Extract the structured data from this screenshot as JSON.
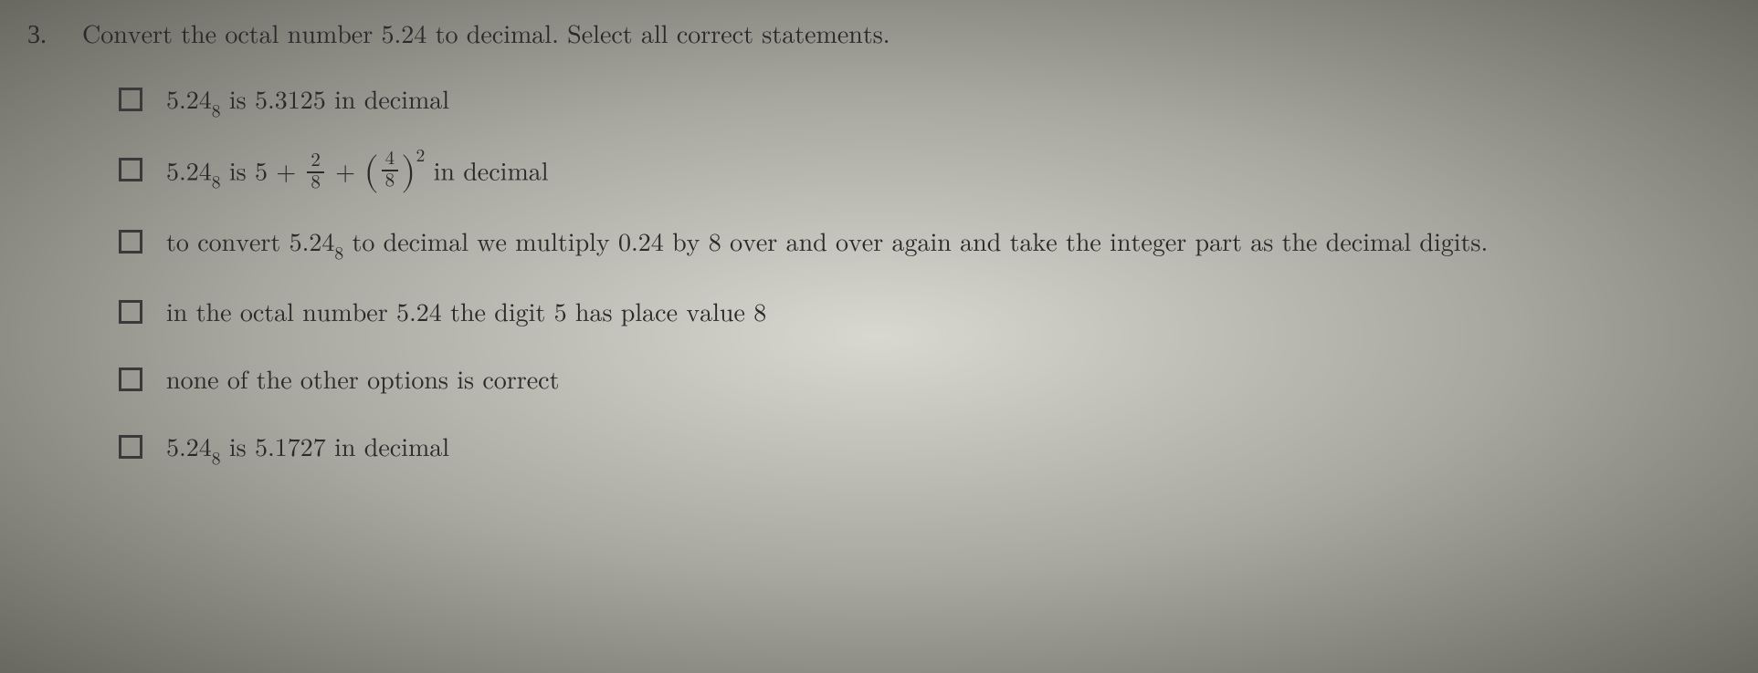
{
  "question": {
    "number": "3.",
    "text": "Convert the octal number 5.24 to decimal. Select all correct statements."
  },
  "options": [
    {
      "prefix": "5.24",
      "sub": "8",
      "mid": " is ",
      "val": "5.3125",
      "suffix": " in decimal"
    },
    {
      "prefix": "5.24",
      "sub": "8",
      "mid": " is ",
      "expr": {
        "a": "5",
        "plus1": " + ",
        "frac1_num": "2",
        "frac1_den": "8",
        "plus2": " + ",
        "frac2_num": "4",
        "frac2_den": "8",
        "pow": "2"
      },
      "suffix": " in decimal"
    },
    {
      "pre": "to convert ",
      "prefix": "5.24",
      "sub": "8",
      "mid": " to decimal we multiply ",
      "val": "0.24",
      "mid2": " by ",
      "val2": "8",
      "suffix": " over and over again and take the integer part as the decimal digits."
    },
    {
      "pre": "in the octal number ",
      "val": "5.24",
      "mid": " the digit ",
      "val2": "5",
      "mid2": " has place value ",
      "val3": "8"
    },
    {
      "text": "none of the other options is correct"
    },
    {
      "prefix": "5.24",
      "sub": "8",
      "mid": " is ",
      "val": "5.1727",
      "suffix": " in decimal"
    }
  ]
}
